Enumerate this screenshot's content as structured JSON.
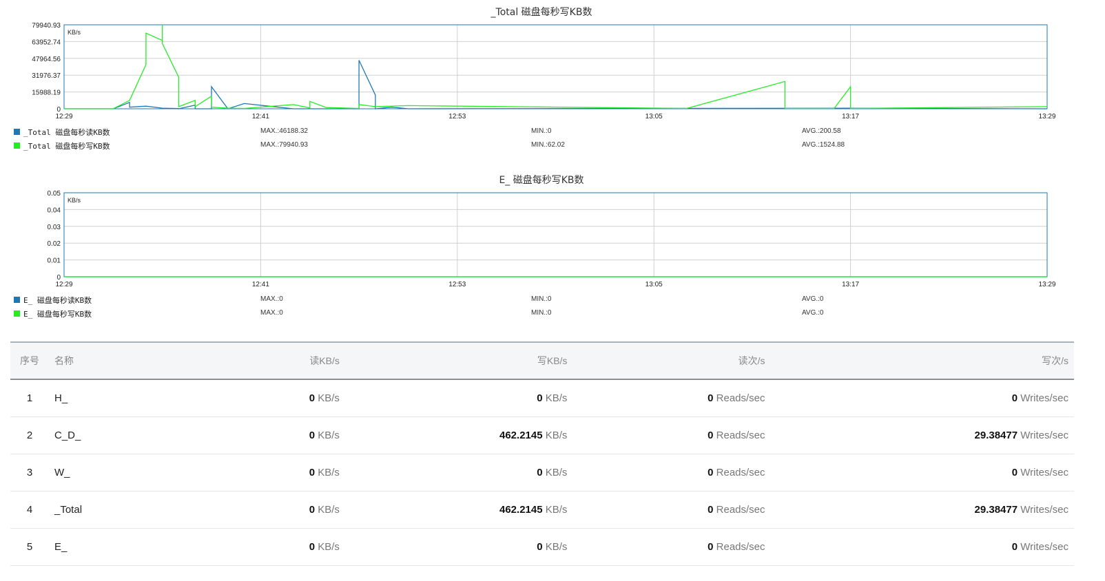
{
  "charts": [
    {
      "title": "_Total  磁盘每秒写KB数",
      "unit": "KB/s",
      "yticks": [
        "0",
        "15988.19",
        "31976.37",
        "47964.56",
        "63952.74",
        "79940.93"
      ],
      "xticks": [
        "12:29",
        "12:41",
        "12:53",
        "13:05",
        "13:17",
        "13:29"
      ],
      "legend": [
        {
          "name": "_Total 磁盘每秒读KB数",
          "color": "#1f77b4",
          "max": "MAX.:46188.32",
          "min": "MIN.:0",
          "avg": "AVG.:200.58"
        },
        {
          "name": "_Total 磁盘每秒写KB数",
          "color": "#22ee22",
          "max": "MAX.:79940.93",
          "min": "MIN.:62.02",
          "avg": "AVG.:1524.88"
        }
      ]
    },
    {
      "title": "E_  磁盘每秒写KB数",
      "unit": "KB/s",
      "yticks": [
        "0",
        "0.01",
        "0.02",
        "0.03",
        "0.04",
        "0.05"
      ],
      "xticks": [
        "12:29",
        "12:41",
        "12:53",
        "13:05",
        "13:17",
        "13:29"
      ],
      "legend": [
        {
          "name": "E_ 磁盘每秒读KB数",
          "color": "#1f77b4",
          "max": "MAX.:0",
          "min": "MIN.:0",
          "avg": "AVG.:0"
        },
        {
          "name": "E_ 磁盘每秒写KB数",
          "color": "#22ee22",
          "max": "MAX.:0",
          "min": "MIN.:0",
          "avg": "AVG.:0"
        }
      ]
    }
  ],
  "chart_data": [
    {
      "type": "line",
      "title": "_Total  磁盘每秒写KB数",
      "ylabel": "KB/s",
      "xlim": [
        "12:29",
        "13:29"
      ],
      "ylim": [
        0,
        79940.93
      ],
      "grid": true,
      "series": [
        {
          "name": "_Total 磁盘每秒读KB数",
          "color": "#1f77b4",
          "x": [
            "12:29",
            "12:32",
            "12:33",
            "12:33",
            "12:34",
            "12:35",
            "12:36",
            "12:36",
            "12:37",
            "12:37",
            "12:38",
            "12:38",
            "12:39",
            "12:40",
            "12:43",
            "12:44",
            "12:47",
            "12:47",
            "12:48",
            "12:48",
            "12:49",
            "12:50",
            "13:17",
            "13:29"
          ],
          "y": [
            0,
            0,
            6000,
            1500,
            2500,
            600,
            200,
            0,
            3500,
            0,
            0,
            21000,
            0,
            5000,
            0,
            0,
            0,
            46188.32,
            13000,
            0,
            1500,
            0,
            600,
            0
          ]
        },
        {
          "name": "_Total 磁盘每秒写KB数",
          "color": "#22ee22",
          "x": [
            "12:29",
            "12:32",
            "12:33",
            "12:34",
            "12:34",
            "12:34",
            "12:35",
            "12:35",
            "12:35",
            "12:36",
            "12:36",
            "12:37",
            "12:37",
            "12:38",
            "12:38",
            "12:39",
            "12:40",
            "12:43",
            "12:44",
            "12:44",
            "12:45",
            "12:47",
            "12:47",
            "12:48",
            "12:50",
            "13:07",
            "13:13",
            "13:13",
            "13:14",
            "13:16",
            "13:17",
            "13:17",
            "13:29"
          ],
          "y": [
            62.02,
            62.02,
            8000,
            42000,
            68000,
            72000,
            65000,
            79940.93,
            62000,
            30000,
            2000,
            8000,
            2000,
            12000,
            1500,
            500,
            300,
            4000,
            800,
            7000,
            1200,
            300,
            4000,
            2000,
            3000,
            300,
            26000,
            300,
            300,
            300,
            21000,
            300,
            2000
          ]
        }
      ]
    },
    {
      "type": "line",
      "title": "E_  磁盘每秒写KB数",
      "ylabel": "KB/s",
      "xlim": [
        "12:29",
        "13:29"
      ],
      "ylim": [
        0,
        0.05
      ],
      "grid": true,
      "series": [
        {
          "name": "E_ 磁盘每秒读KB数",
          "color": "#1f77b4",
          "x": [
            "12:29",
            "13:29"
          ],
          "y": [
            0,
            0
          ]
        },
        {
          "name": "E_ 磁盘每秒写KB数",
          "color": "#22ee22",
          "x": [
            "12:29",
            "13:29"
          ],
          "y": [
            0,
            0
          ]
        }
      ]
    }
  ],
  "table": {
    "headers": [
      "序号",
      "名称",
      "读KB/s",
      "写KB/s",
      "读次/s",
      "写次/s"
    ],
    "rows": [
      {
        "idx": "1",
        "name": "H_",
        "read": "0",
        "read_unit": "KB/s",
        "write": "0",
        "write_unit": "KB/s",
        "reads": "0",
        "reads_unit": "Reads/sec",
        "writes": "0",
        "writes_unit": "Writes/sec"
      },
      {
        "idx": "2",
        "name": "C_D_",
        "read": "0",
        "read_unit": "KB/s",
        "write": "462.2145",
        "write_unit": "KB/s",
        "reads": "0",
        "reads_unit": "Reads/sec",
        "writes": "29.38477",
        "writes_unit": "Writes/sec"
      },
      {
        "idx": "3",
        "name": "W_",
        "read": "0",
        "read_unit": "KB/s",
        "write": "0",
        "write_unit": "KB/s",
        "reads": "0",
        "reads_unit": "Reads/sec",
        "writes": "0",
        "writes_unit": "Writes/sec"
      },
      {
        "idx": "4",
        "name": "_Total",
        "read": "0",
        "read_unit": "KB/s",
        "write": "462.2145",
        "write_unit": "KB/s",
        "reads": "0",
        "reads_unit": "Reads/sec",
        "writes": "29.38477",
        "writes_unit": "Writes/sec"
      },
      {
        "idx": "5",
        "name": "E_",
        "read": "0",
        "read_unit": "KB/s",
        "write": "0",
        "write_unit": "KB/s",
        "reads": "0",
        "reads_unit": "Reads/sec",
        "writes": "0",
        "writes_unit": "Writes/sec"
      }
    ]
  }
}
